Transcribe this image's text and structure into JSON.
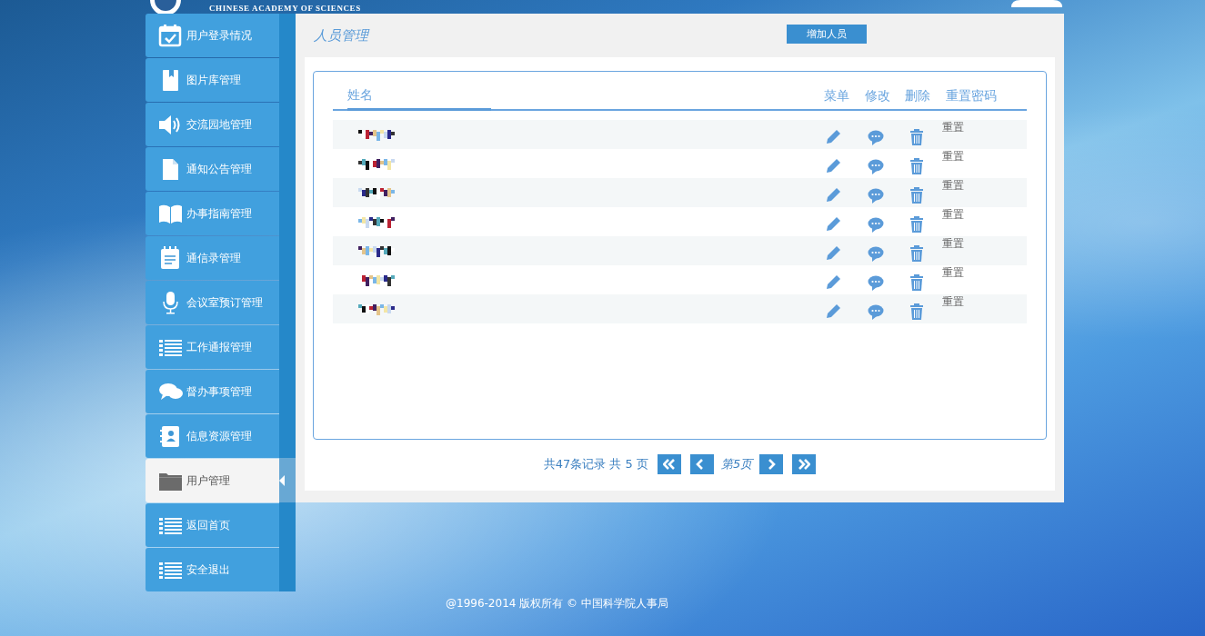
{
  "header": {
    "org_name_en": "CHINESE ACADEMY OF SCIENCES"
  },
  "sidebar": {
    "items": [
      {
        "label": "用户登录情况",
        "kind": "calendar",
        "selected": false
      },
      {
        "label": "图片库管理",
        "kind": "book",
        "selected": false
      },
      {
        "label": "交流园地管理",
        "kind": "speaker",
        "selected": false
      },
      {
        "label": "通知公告管理",
        "kind": "document",
        "selected": false
      },
      {
        "label": "办事指南管理",
        "kind": "openbook",
        "selected": false
      },
      {
        "label": "通信录管理",
        "kind": "notepad",
        "selected": false
      },
      {
        "label": "会议室预订管理",
        "kind": "microphone",
        "selected": false
      },
      {
        "label": "工作通报管理",
        "kind": "list",
        "selected": false
      },
      {
        "label": "督办事项管理",
        "kind": "chat",
        "selected": false
      },
      {
        "label": "信息资源管理",
        "kind": "contacts",
        "selected": false
      },
      {
        "label": "用户管理",
        "kind": "folder",
        "selected": true
      },
      {
        "label": "返回首页",
        "kind": "list",
        "selected": false
      },
      {
        "label": "安全退出",
        "kind": "list",
        "selected": false
      }
    ]
  },
  "page": {
    "title": "人员管理",
    "add_button": "增加人员"
  },
  "table": {
    "columns": [
      "姓名",
      "菜单",
      "修改",
      "删除",
      "重置密码"
    ],
    "rows": [
      {
        "reset": "重置"
      },
      {
        "reset": "重置"
      },
      {
        "reset": "重置"
      },
      {
        "reset": "重置"
      },
      {
        "reset": "重置"
      },
      {
        "reset": "重置"
      },
      {
        "reset": "重置"
      }
    ]
  },
  "pager": {
    "summary": "共47条记录 共 5 页",
    "current": "第5页"
  },
  "footer": "@1996-2014 版权所有 © 中国科学院人事局"
}
